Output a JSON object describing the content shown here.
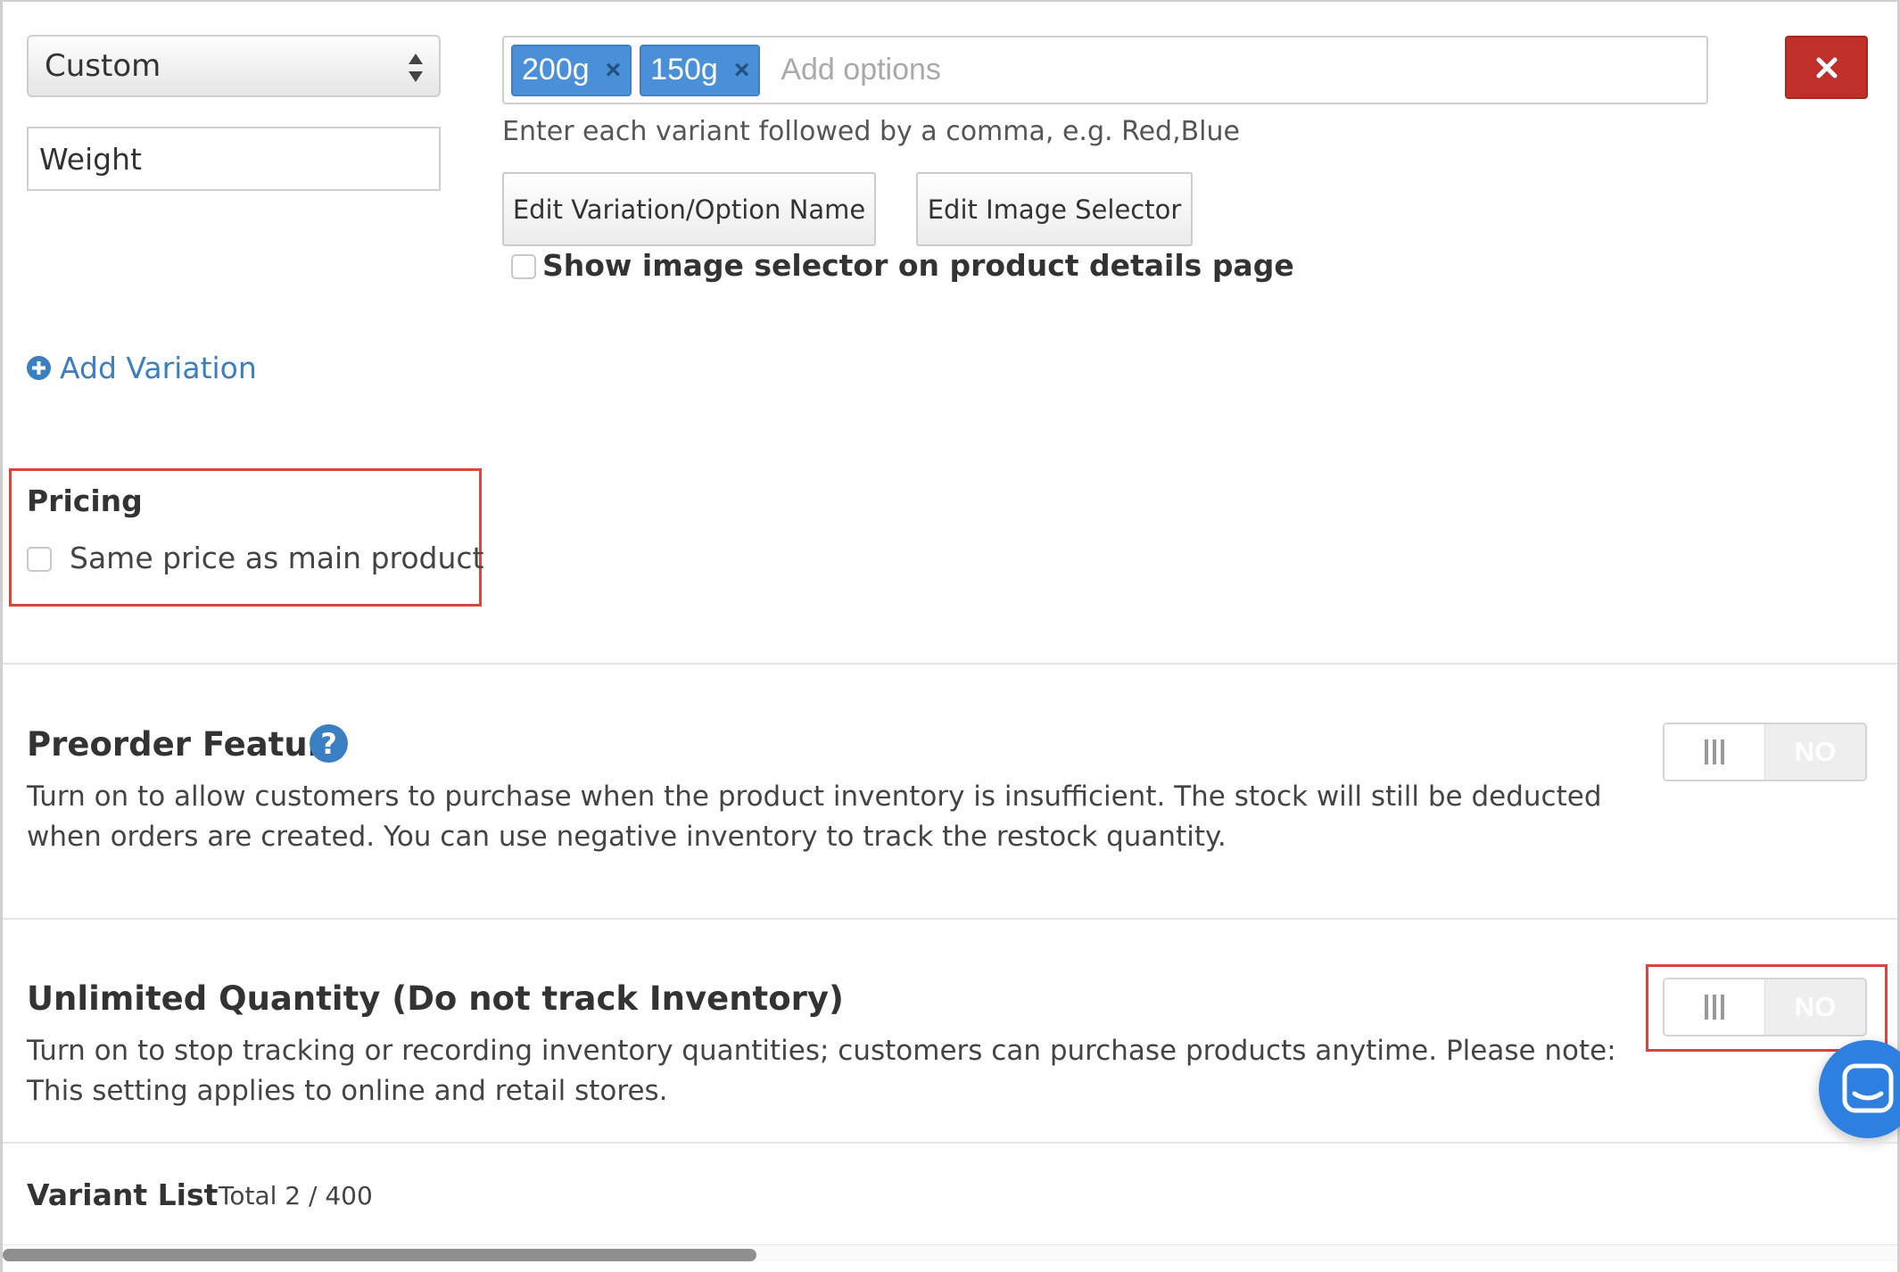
{
  "variation": {
    "type_select": {
      "value": "Custom"
    },
    "name_input": {
      "value": "Weight"
    },
    "options": {
      "tags": [
        {
          "label": "200g",
          "remove": "×"
        },
        {
          "label": "150g",
          "remove": "×"
        }
      ],
      "placeholder": "Add options"
    },
    "help_text": "Enter each variant followed by a comma, e.g. Red,Blue",
    "edit_name_button": "Edit Variation/Option Name",
    "edit_image_button": "Edit Image Selector",
    "show_image_selector_label": "Show image selector on product details page",
    "show_image_selector_checked": false,
    "add_variation_label": "Add Variation"
  },
  "pricing": {
    "title": "Pricing",
    "same_price_label": "Same price as main product",
    "same_price_checked": false
  },
  "preorder": {
    "title": "Preorder Feature",
    "help_icon": "?",
    "description": "Turn on to allow customers to purchase when the product inventory is insufficient. The stock will still be deducted when orders are created. You can use negative inventory to track the restock quantity.",
    "toggle_state": "NO"
  },
  "unlimited": {
    "title": "Unlimited Quantity (Do not track Inventory)",
    "description": "Turn on to stop tracking or recording inventory quantities; customers can purchase products anytime. Please note: This setting applies to online and retail stores.",
    "toggle_state": "NO"
  },
  "variant_list": {
    "title": "Variant List",
    "total": "Total 2 / 400"
  },
  "colors": {
    "tag_blue": "#4a90d9",
    "link_blue": "#3a7fc1",
    "danger_red": "#c0302a",
    "highlight_red": "#d9473c",
    "chat_blue": "#2d7fe0"
  },
  "icons": {
    "select_arrows": "sort-arrows-icon",
    "delete": "close-icon",
    "add": "plus-circle-icon",
    "help": "question-circle-icon",
    "toggle_handle": "grip-bars-icon",
    "chat": "chat-bubble-icon"
  }
}
